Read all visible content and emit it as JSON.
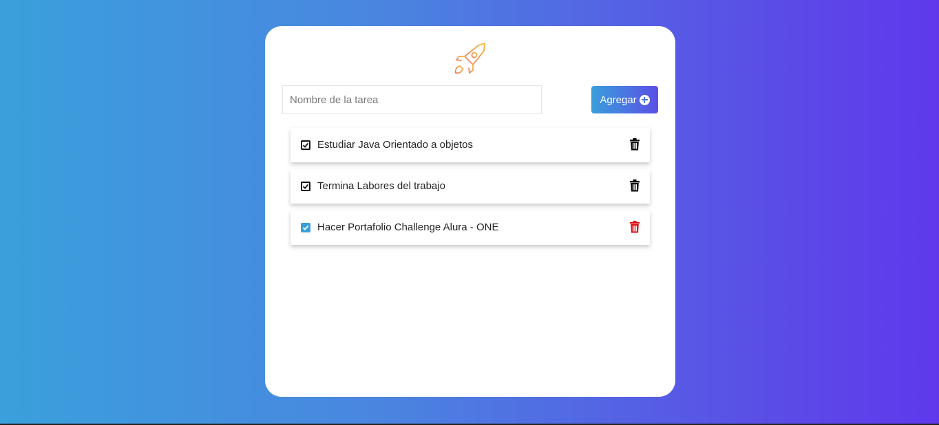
{
  "form": {
    "input_placeholder": "Nombre de la tarea",
    "input_value": "",
    "add_button_label": "Agregar",
    "add_icon": "plus-circle-icon"
  },
  "logo": {
    "icon": "rocket-icon",
    "color": "#f3a53f"
  },
  "tasks": [
    {
      "text": "Estudiar Java Orientado a objetos",
      "checked": true,
      "style": "outline",
      "delete_icon_color": "#000000"
    },
    {
      "text": "Termina Labores del trabajo",
      "checked": true,
      "style": "outline",
      "delete_icon_color": "#000000"
    },
    {
      "text": "Hacer Portafolio Challenge Alura - ONE",
      "checked": true,
      "style": "filled",
      "delete_icon_color": "#e01010"
    }
  ],
  "colors": {
    "accent_start": "#3a9fdc",
    "accent_end": "#5f38ec"
  }
}
